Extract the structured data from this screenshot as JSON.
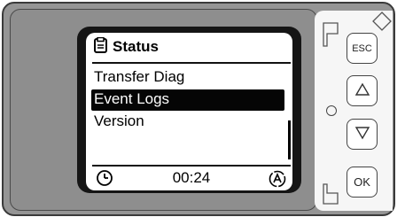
{
  "screen": {
    "title": "Status",
    "menu_items": [
      "Transfer Diag",
      "Event Logs",
      "Version"
    ],
    "selected_index": 1,
    "time": "00:24"
  },
  "buttons": {
    "esc_label": "ESC",
    "ok_label": "OK"
  },
  "icons": {
    "title": "clipboard-icon",
    "bottom_left": "clock-icon",
    "bottom_right": "auto-mode-icon",
    "up": "up-arrow-icon",
    "down": "down-arrow-icon"
  }
}
